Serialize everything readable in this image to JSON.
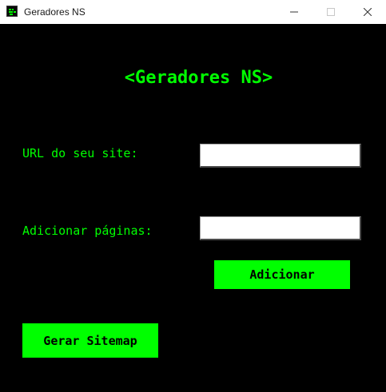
{
  "window": {
    "title": "Geradores NS",
    "icon": "terminal-icon"
  },
  "main": {
    "heading": "<Geradores NS>",
    "url_label": "URL do seu site:",
    "url_value": "",
    "pages_label": "Adicionar páginas:",
    "pages_value": "",
    "add_button": "Adicionar",
    "sitemap_button": "Gerar Sitemap"
  },
  "colors": {
    "background": "#000000",
    "accent": "#00ff00",
    "titlebar": "#ffffff"
  }
}
